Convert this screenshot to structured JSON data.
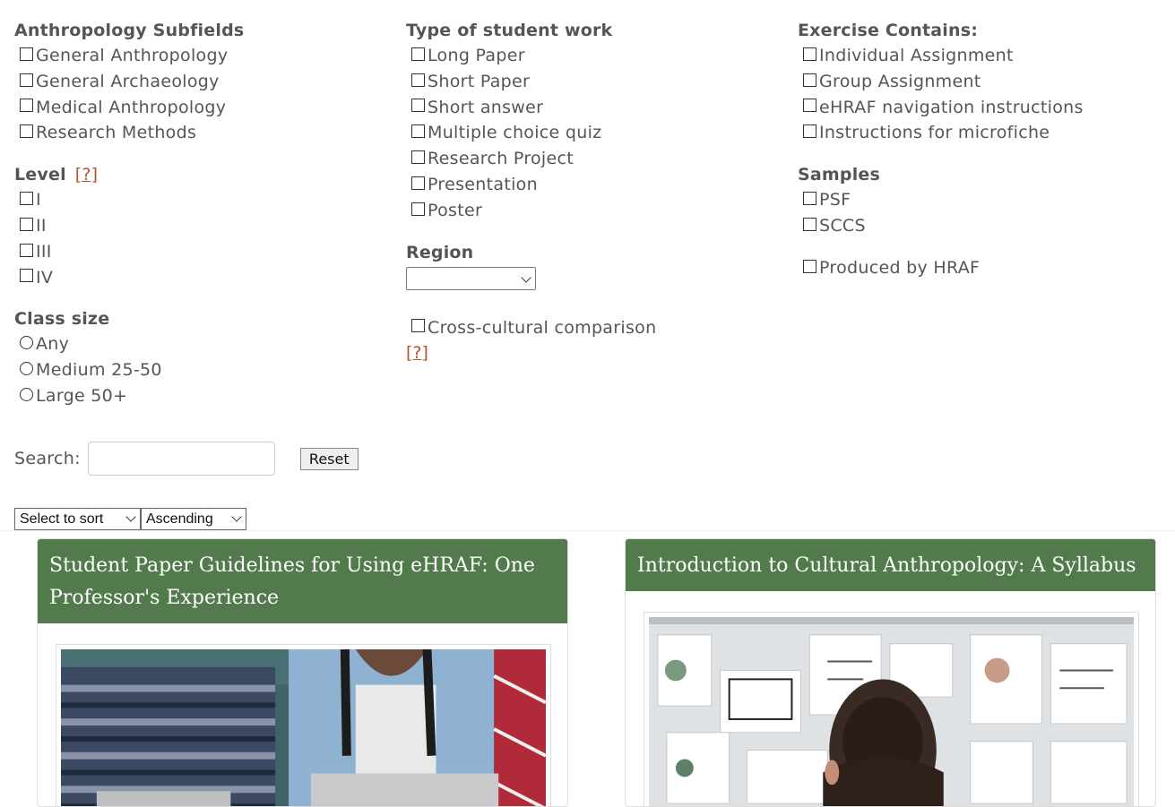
{
  "filters": {
    "subfields": {
      "title": "Anthropology Subfields",
      "options": [
        "General Anthropology",
        "General Archaeology",
        "Medical Anthropology",
        "Research Methods"
      ]
    },
    "level": {
      "title": "Level",
      "help": "[?]",
      "options": [
        "I",
        "II",
        "III",
        "IV"
      ]
    },
    "class_size": {
      "title": "Class size",
      "options": [
        "Any",
        "Medium 25-50",
        "Large 50+"
      ]
    },
    "student_work": {
      "title": "Type of student work",
      "options": [
        "Long Paper",
        "Short Paper",
        "Short answer",
        "Multiple choice quiz",
        "Research Project",
        "Presentation",
        "Poster"
      ]
    },
    "region": {
      "title": "Region",
      "selected": ""
    },
    "cross_cultural": {
      "label": "Cross-cultural comparison",
      "help": "[?]"
    },
    "exercise_contains": {
      "title": "Exercise Contains:",
      "options": [
        "Individual Assignment",
        "Group Assignment",
        "eHRAF navigation instructions",
        "Instructions for microfiche"
      ]
    },
    "samples": {
      "title": "Samples",
      "options": [
        "PSF",
        "SCCS"
      ]
    },
    "produced_by": {
      "label": "Produced by HRAF"
    }
  },
  "search": {
    "label": "Search:",
    "value": "",
    "reset_label": "Reset"
  },
  "sort": {
    "field": "Select to sort",
    "order": "Ascending"
  },
  "cards": [
    {
      "title": "Student Paper Guidelines for Using eHRAF: One Professor's Experience"
    },
    {
      "title": "Introduction to Cultural Anthropology: A Syllabus"
    }
  ],
  "colors": {
    "card_header": "#527a4c",
    "help_link": "#b5542b",
    "text": "#555555"
  }
}
